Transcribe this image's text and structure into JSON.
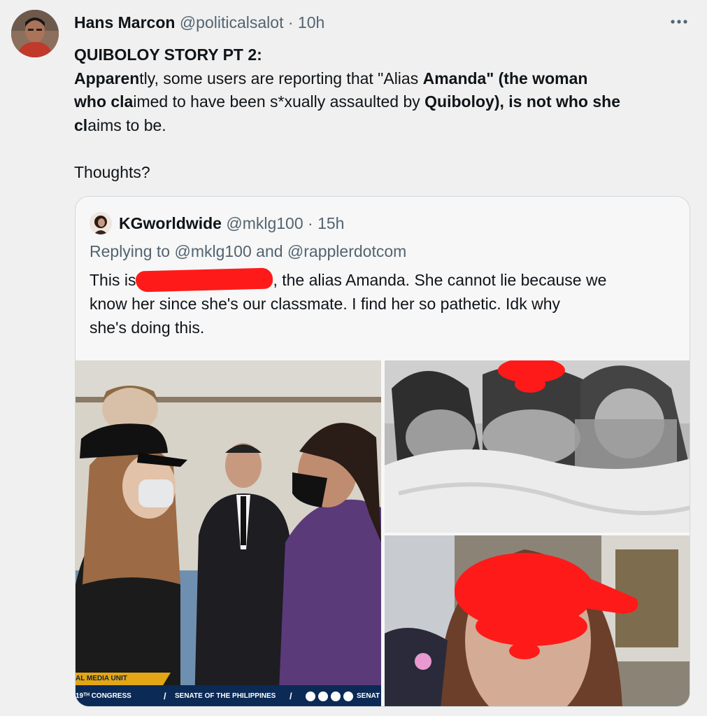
{
  "tweet": {
    "author_name": "Hans Marcon",
    "author_handle": "@politicalsalot",
    "separator": "·",
    "time": "10h",
    "more_icon": "more-icon",
    "title": "QUIBOLOY STORY PT 2:",
    "body_1a": "Apparen",
    "body_1b": "tly, some users are reporting that \"Alias ",
    "body_1c": "Amanda\" (the woman",
    "body_2a": "who cla",
    "body_2b": "imed to have been s*xually assaulted by ",
    "body_2c": "Quiboloy), is not who she",
    "body_3a": "cl",
    "body_3b": "aims to be.",
    "thoughts": "Thoughts?"
  },
  "quote": {
    "author_name": "KGworldwide",
    "author_handle": "@mklg100",
    "separator": "·",
    "time": "15h",
    "reply_prefix": "Replying to ",
    "reply_to_1": "@mklg100",
    "reply_and": " and ",
    "reply_to_2": "@rapplerdotcom",
    "text_1a": "This is",
    "text_1b": ", the alias Amanda. She cannot lie because we",
    "text_2": "know her since she's our classmate. I find her so pathetic. Idk why",
    "text_3": "she's doing this."
  },
  "media": {
    "ticker_unit": "AL MEDIA UNIT",
    "ticker_congress": "19ᵀᴴ CONGRESS",
    "ticker_senate": "SENATE OF THE PHILIPPINES",
    "ticker_slash": "/",
    "ticker_social_icons": "social-icons",
    "ticker_senat": "SENAT"
  },
  "colors": {
    "background": "#f0f0f0",
    "text_primary": "#0f1419",
    "text_secondary": "#536471",
    "redaction": "#ff1a1a",
    "ticker_blue": "#0b2a55",
    "ticker_gold": "#e3a614"
  }
}
